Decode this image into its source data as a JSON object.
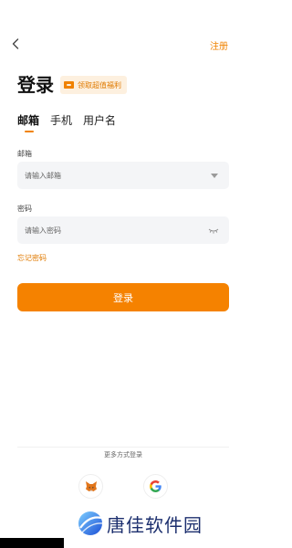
{
  "header": {
    "register_label": "注册"
  },
  "title": "登录",
  "promo": {
    "label": "领取超值福利"
  },
  "tabs": [
    {
      "label": "邮箱",
      "active": true
    },
    {
      "label": "手机",
      "active": false
    },
    {
      "label": "用户名",
      "active": false
    }
  ],
  "email": {
    "label": "邮箱",
    "placeholder": "请输入邮箱",
    "value": ""
  },
  "password": {
    "label": "密码",
    "placeholder": "请输入密码",
    "value": ""
  },
  "forgot_label": "忘记密码",
  "login_label": "登录",
  "more_methods_label": "更多方式登录",
  "oauth_providers": [
    "metamask-icon",
    "google-icon"
  ],
  "watermark": {
    "text": "唐佳软件园"
  },
  "colors": {
    "accent": "#F58200",
    "promo_bg": "#FDF0DF",
    "field_bg": "#F4F5F7"
  }
}
